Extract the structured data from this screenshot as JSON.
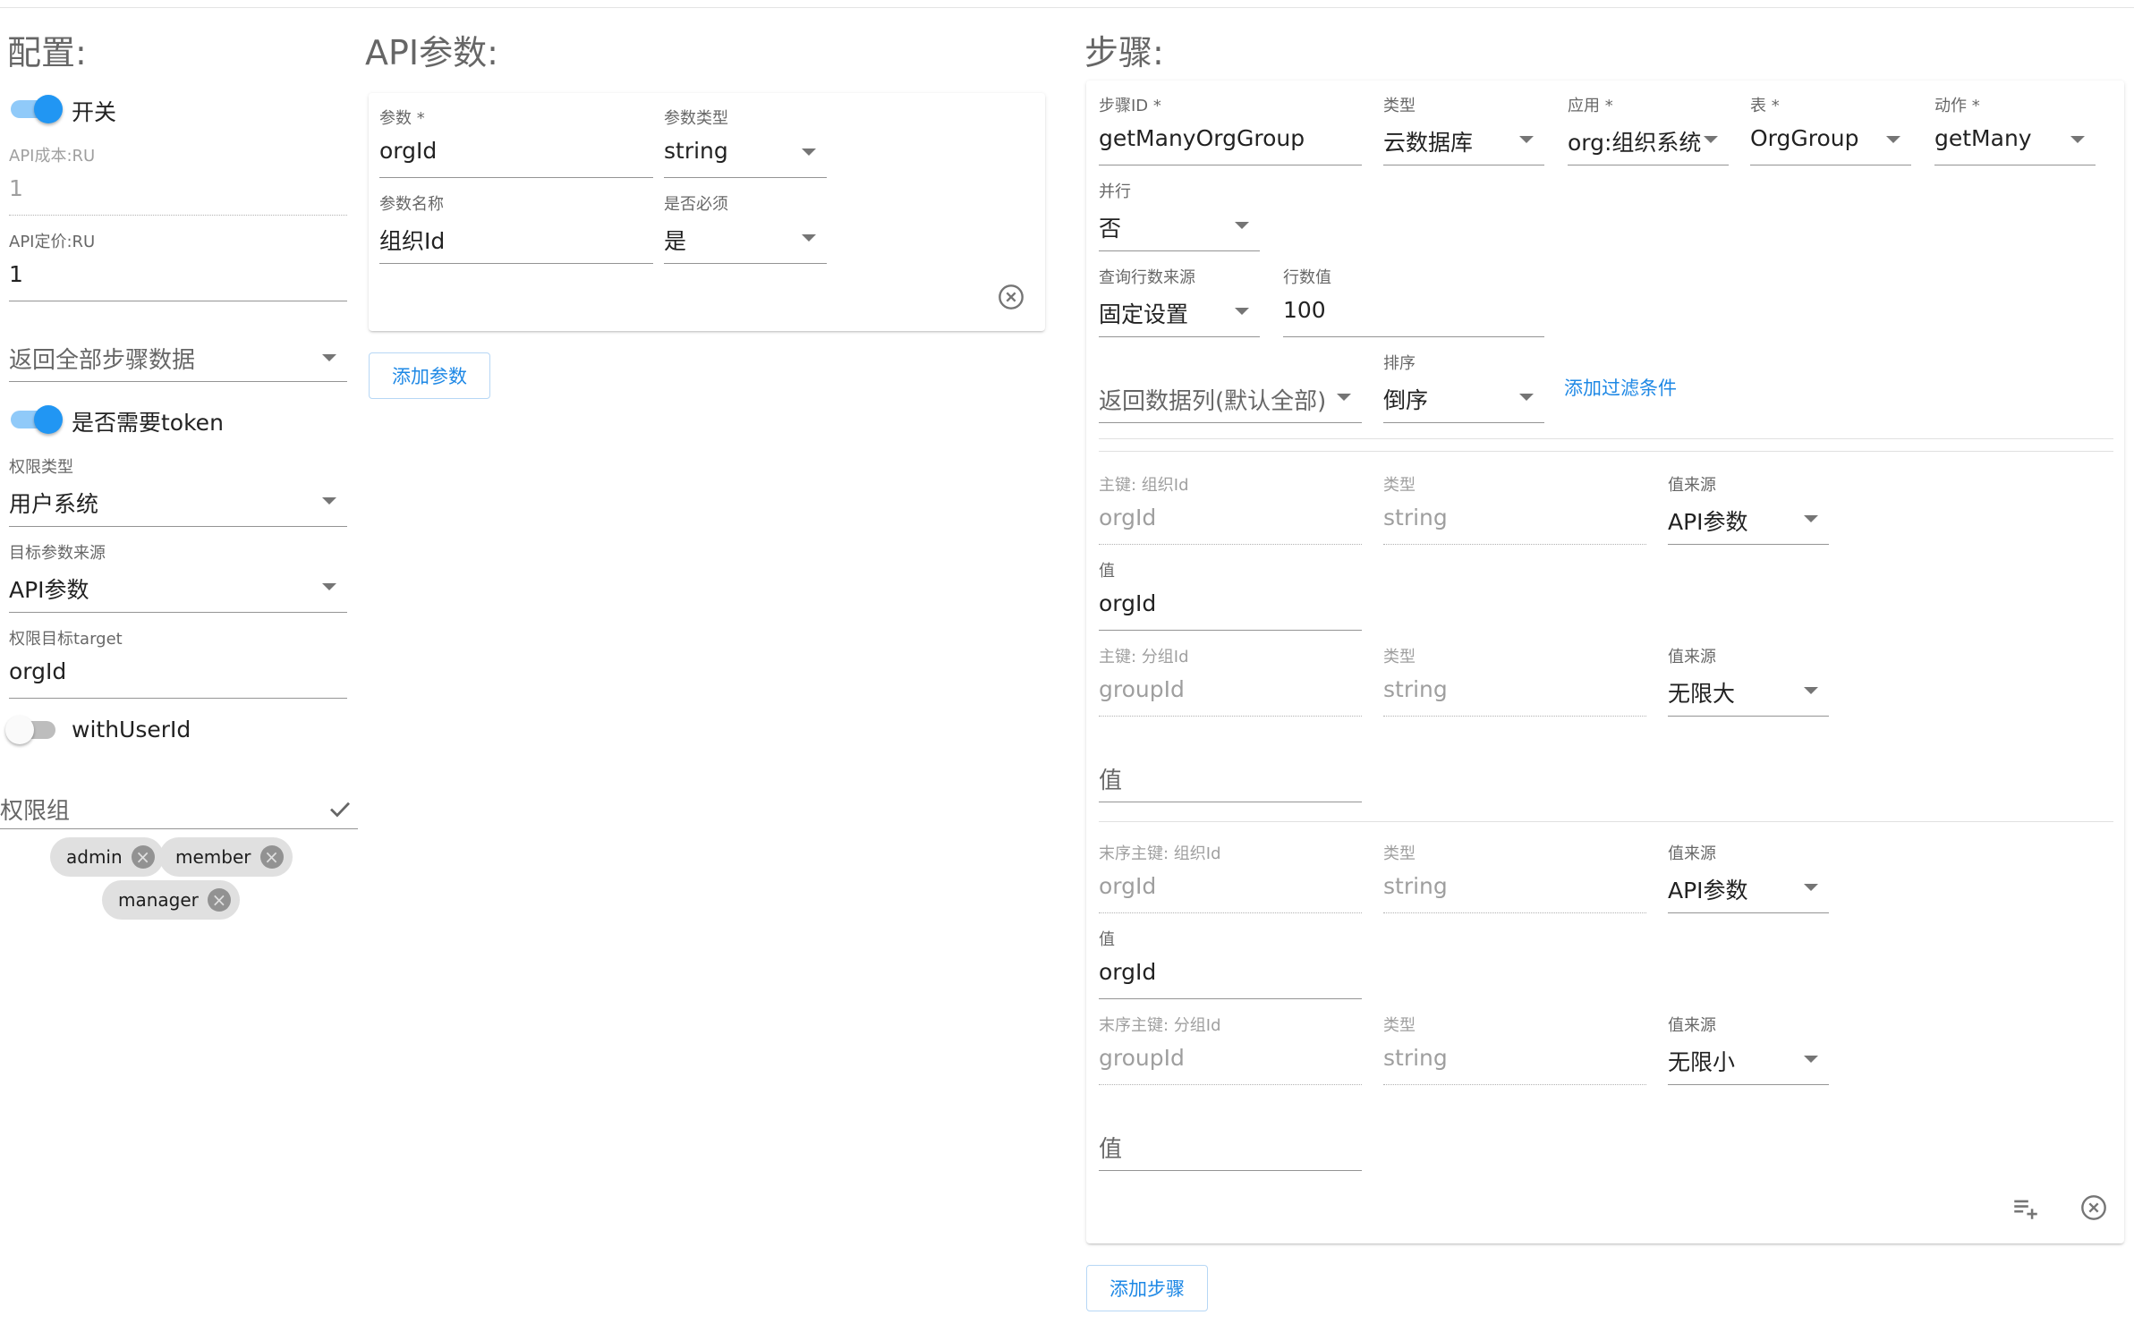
{
  "config": {
    "title": "配置:",
    "switch_label": "开关",
    "api_cost_label": "API成本:RU",
    "api_cost_value": "1",
    "api_price_label": "API定价:RU",
    "api_price_value": "1",
    "return_select": "返回全部步骤数据",
    "token_label": "是否需要token",
    "perm_type_label": "权限类型",
    "perm_type_value": "用户系统",
    "target_source_label": "目标参数来源",
    "target_source_value": "API参数",
    "perm_target_label": "权限目标target",
    "perm_target_value": "orgId",
    "with_user_id_label": "withUserId",
    "perm_group_label": "权限组",
    "chips": [
      "admin",
      "member",
      "manager"
    ]
  },
  "api_params": {
    "title": "API参数:",
    "param_label": "参数 *",
    "param_value": "orgId",
    "param_type_label": "参数类型",
    "param_type_value": "string",
    "param_name_label": "参数名称",
    "param_name_value": "组织Id",
    "required_label": "是否必须",
    "required_value": "是",
    "add_button": "添加参数"
  },
  "steps": {
    "title": "步骤:",
    "step_id_label": "步骤ID *",
    "step_id_value": "getManyOrgGroup",
    "type_label": "类型",
    "type_value": "云数据库",
    "app_label": "应用 *",
    "app_value": "org:组织系统",
    "table_label": "表 *",
    "table_value": "OrgGroup",
    "action_label": "动作 *",
    "action_value": "getMany",
    "parallel_label": "并行",
    "parallel_value": "否",
    "rowsource_label": "查询行数来源",
    "rowsource_value": "固定设置",
    "rowcount_label": "行数值",
    "rowcount_value": "100",
    "return_cols_placeholder": "返回数据列(默认全部)",
    "sort_label": "排序",
    "sort_value": "倒序",
    "add_filter": "添加过滤条件",
    "keys": [
      {
        "key_label": "主键: 组织Id",
        "key_value": "orgId",
        "type_label": "类型",
        "type_value": "string",
        "src_label": "值来源",
        "src_value": "API参数",
        "val_label": "值",
        "val_value": "orgId"
      },
      {
        "key_label": "主键: 分组Id",
        "key_value": "groupId",
        "type_label": "类型",
        "type_value": "string",
        "src_label": "值来源",
        "src_value": "无限大",
        "val_placeholder": "值"
      },
      {
        "key_label": "末序主键: 组织Id",
        "key_value": "orgId",
        "type_label": "类型",
        "type_value": "string",
        "src_label": "值来源",
        "src_value": "API参数",
        "val_label": "值",
        "val_value": "orgId"
      },
      {
        "key_label": "末序主键: 分组Id",
        "key_value": "groupId",
        "type_label": "类型",
        "type_value": "string",
        "src_label": "值来源",
        "src_value": "无限小",
        "val_placeholder": "值"
      }
    ],
    "add_button": "添加步骤"
  },
  "icons": {
    "check": "check-icon",
    "close": "close-circle-icon",
    "playlist_add": "playlist-add-icon",
    "chip_remove": "cancel-icon"
  },
  "colors": {
    "primary": "#2196f3",
    "switch_track": "#90caf9",
    "link": "#1e88e5"
  }
}
